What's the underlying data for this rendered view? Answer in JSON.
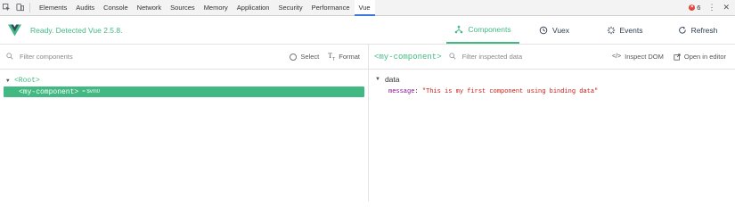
{
  "devtools": {
    "tabs": [
      "Elements",
      "Audits",
      "Console",
      "Network",
      "Sources",
      "Memory",
      "Application",
      "Security",
      "Performance",
      "Vue"
    ],
    "active_tab": "Vue",
    "error_count": "6",
    "icons": [
      "inspect-cursor-icon",
      "device-toolbar-icon",
      "error-icon",
      "more-vert-icon",
      "close-icon"
    ]
  },
  "vue_header": {
    "status": "Ready. Detected Vue 2.5.8.",
    "tabs": [
      {
        "label": "Components",
        "icon": "components-icon",
        "active": true
      },
      {
        "label": "Vuex",
        "icon": "history-icon",
        "active": false
      },
      {
        "label": "Events",
        "icon": "events-icon",
        "active": false
      },
      {
        "label": "Refresh",
        "icon": "refresh-icon",
        "active": false
      }
    ],
    "accent_color": "#42b983"
  },
  "components_pane": {
    "filter_placeholder": "Filter components",
    "select_label": "Select",
    "format_label": "Format",
    "tree": {
      "root": "<Root>",
      "child": "<my-component>",
      "child_ref": "= $vm0"
    }
  },
  "inspector_pane": {
    "component_name": "<my-component>",
    "filter_placeholder": "Filter inspected data",
    "inspect_dom_label": "Inspect DOM",
    "open_editor_label": "Open in editor",
    "section_title": "data",
    "property": {
      "key": "message",
      "value": "\"This is my first component using binding data\""
    }
  }
}
